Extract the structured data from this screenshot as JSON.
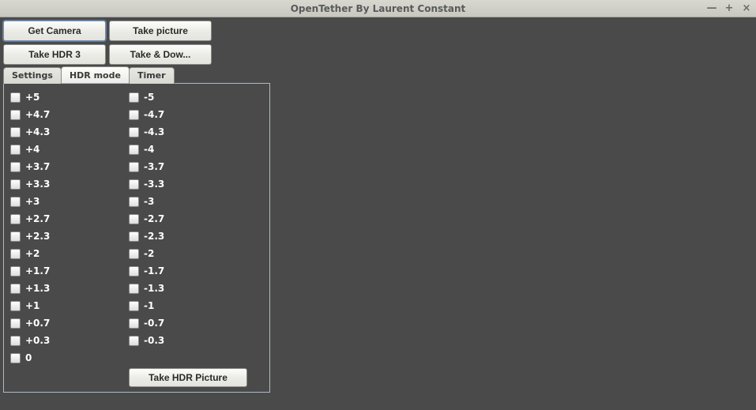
{
  "window": {
    "title": "OpenTether By Laurent Constant"
  },
  "toolbar": {
    "get_camera": "Get Camera",
    "take_picture": "Take picture",
    "take_hdr3": "Take HDR 3",
    "take_download": "Take & Dow..."
  },
  "tabs": {
    "settings": "Settings",
    "hdr_mode": "HDR mode",
    "timer": "Timer",
    "active": "hdr_mode"
  },
  "hdr": {
    "col_left": [
      "+5",
      "+4.7",
      "+4.3",
      "+4",
      "+3.7",
      "+3.3",
      "+3",
      "+2.7",
      "+2.3",
      "+2",
      "+1.7",
      "+1.3",
      "+1",
      "+0.7",
      "+0.3",
      "0"
    ],
    "col_right": [
      "-5",
      "-4.7",
      "-4.3",
      "-4",
      "-3.7",
      "-3.3",
      "-3",
      "-2.7",
      "-2.3",
      "-2",
      "-1.7",
      "-1.3",
      "-1",
      "-0.7",
      "-0.3"
    ],
    "take_hdr_picture": "Take HDR Picture"
  }
}
